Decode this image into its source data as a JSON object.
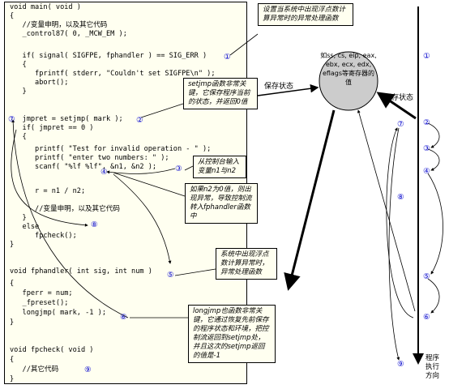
{
  "code": [
    "void main( void )",
    "{",
    "   //变量申明，以及其它代码",
    "   _control87( 0, _MCW_EM );",
    "",
    "   if( signal( SIGFPE, fphandler ) == SIG_ERR )",
    "   {",
    "      fprintf( stderr, \"Couldn't set SIGFPE\\n\" );",
    "      abort();",
    "   }",
    "",
    "   jmpret = setjmp( mark );",
    "   if( jmpret == 0 )",
    "   {",
    "      printf( \"Test for invalid operation - \" );",
    "      printf( \"enter two numbers: \" );",
    "      scanf( \"%lf %lf\", &n1, &n2 );",
    "",
    "      r = n1 / n2;",
    "",
    "      //变量申明，以及其它代码",
    "   }",
    "   else",
    "      fpcheck();",
    "}",
    "",
    "void fphandler( int sig, int num )",
    "{",
    "   fperr = num;",
    "   _fpreset();",
    "   longjmp( mark, -1 );",
    "}",
    "",
    "void fpcheck( void )",
    "{",
    "   //其它代码",
    "}"
  ],
  "refs": {
    "n1": "①",
    "n2": "②",
    "n3": "③",
    "n4": "④",
    "n5": "⑤",
    "n6": "⑥",
    "n7": "⑦",
    "n8": "⑧",
    "n9": "⑨"
  },
  "callouts": {
    "top_right": "设置当系统中出现浮点数计算异常时的异常处理函数",
    "setjmp": "setjmp函数非常关键，它保存程序当前的状态，并返回0值",
    "input": "从控制台输入变量n1与n2",
    "divide": "如果n2为0值，则出现异常，导致控制流转入fphandler函数中",
    "handler": "系统中出现浮点数计算异常时，异常处理函数",
    "longjmp": "longjmp也函数非常关键，它通过恢复先前保存的程序状态和环境，把控制流返回到setjmp处，并且这次的setjmp返回的值是-1"
  },
  "state_circle": "如ss, cs, eip, eax, ebx, ecx, edx, eflags等寄存器的值",
  "arrow_labels": {
    "save_state_left": "保存状态",
    "save_state_right": "保存状态"
  },
  "timeline_label": "程序执行方向",
  "colors": {
    "code_bg": "#fffff0",
    "ref_blue": "#0000cc",
    "circle_fill": "#cccccc"
  }
}
